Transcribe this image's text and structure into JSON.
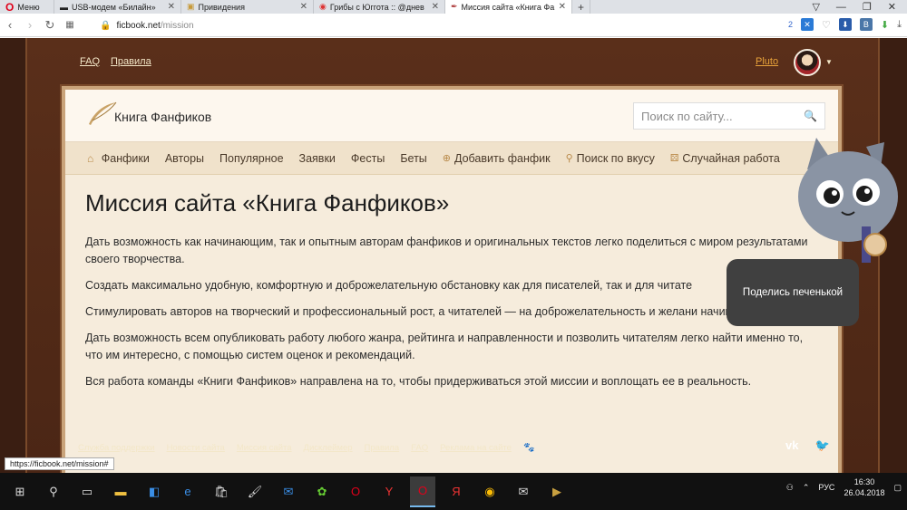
{
  "browser": {
    "menu_label": "Меню",
    "tabs": [
      {
        "title": "USB-модем «Билайн»",
        "active": false
      },
      {
        "title": "Привидения",
        "active": false
      },
      {
        "title": "Грибы с Юггота :: @днев",
        "active": false
      },
      {
        "title": "Миссия сайта «Книга Фа",
        "active": true
      }
    ],
    "url_host": "ficbook.net",
    "url_path": "/mission",
    "badge_count": "2"
  },
  "site": {
    "top_links": [
      "FAQ",
      "Правила"
    ],
    "username": "Pluto",
    "logo_text": "Книга Фанфиков",
    "search_placeholder": "Поиск по сайту...",
    "nav": [
      {
        "label": "Фанфики",
        "icon": ""
      },
      {
        "label": "Авторы",
        "icon": ""
      },
      {
        "label": "Популярное",
        "icon": ""
      },
      {
        "label": "Заявки",
        "icon": ""
      },
      {
        "label": "Фесты",
        "icon": ""
      },
      {
        "label": "Беты",
        "icon": ""
      },
      {
        "label": "Добавить фанфик",
        "icon": "plus-circle-icon"
      },
      {
        "label": "Поиск по вкусу",
        "icon": "search-icon"
      },
      {
        "label": "Случайная работа",
        "icon": "dice-icon"
      }
    ],
    "page_title": "Миссия сайта «Книга Фанфиков»",
    "paragraphs": [
      "Дать возможность как начинающим, так и опытным авторам фанфиков и оригинальных текстов легко поделиться с миром результатами своего творчества.",
      "Создать максимально удобную, комфортную и доброжелательную обстановку как для писателей, так и для читате",
      "Стимулировать авторов на творческий и профессиональный рост, а читателей — на доброжелательность и желани начинающих.",
      "Дать возможность всем опубликовать работу любого жанра, рейтинга и направленности и позволить читателям легко найти именно то, что им интересно, с помощью систем оценок и рекомендаций.",
      "Вся работа команды «Книги Фанфиков» направлена на то, чтобы придерживаться этой миссии и воплощать ее в реальность."
    ],
    "footer_links": [
      "Служба поддержки",
      "Новости сайта",
      "Миссия сайта",
      "Дисклеймер",
      "Правила",
      "FAQ",
      "Реклама на сайте"
    ],
    "bubble_text": "Поделись печенькой",
    "status_url": "https://ficbook.net/mission#"
  },
  "taskbar": {
    "lang": "РУС",
    "time": "16:30",
    "date": "26.04.2018"
  },
  "colors": {
    "wood": "#4b2615",
    "paper": "#f6ecdc",
    "accent": "#b98a4a",
    "opera_red": "#e0001a"
  }
}
